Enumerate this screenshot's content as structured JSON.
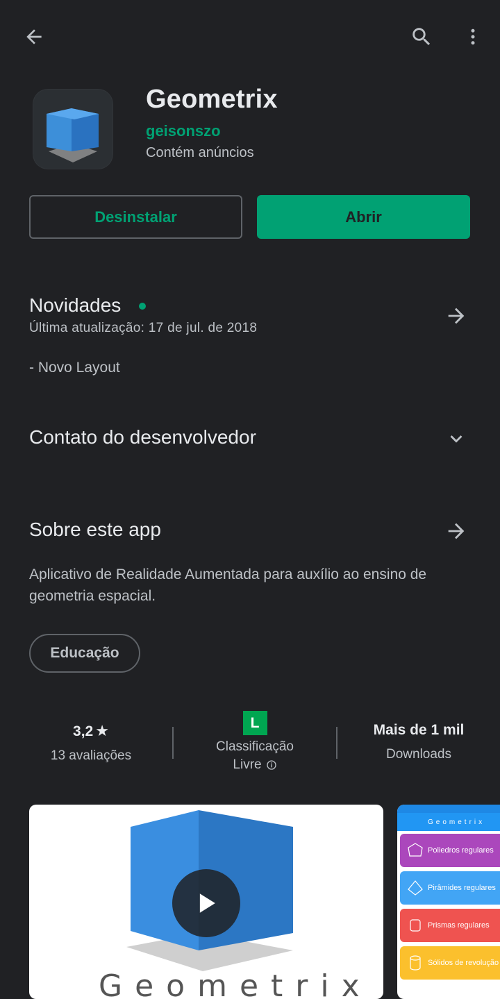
{
  "topbar": {
    "back_icon": "arrow-back-icon",
    "search_icon": "search-icon",
    "more_icon": "more-vert-icon"
  },
  "app": {
    "title": "Geometrix",
    "developer": "geisonszo",
    "ads_notice": "Contém anúncios",
    "icon": "blue-cube-icon"
  },
  "actions": {
    "uninstall_label": "Desinstalar",
    "open_label": "Abrir"
  },
  "news": {
    "title": "Novidades",
    "date": "Última atualização: 17 de jul. de 2018",
    "body": "- Novo Layout"
  },
  "contact": {
    "title": "Contato do desenvolvedor"
  },
  "about": {
    "title": "Sobre este app",
    "body": "Aplicativo de Realidade Aumentada para auxílio ao ensino de geometria espacial.",
    "category": "Educação"
  },
  "stats": {
    "rating_value": "3,2",
    "rating_star": "★",
    "rating_count": "13 avaliações",
    "classification_badge": "L",
    "classification_label": "Classificação",
    "classification_value": "Livre",
    "downloads_value": "Mais de 1 mil",
    "downloads_label": "Downloads"
  },
  "screenshots": {
    "video_caption": "Geometrix",
    "shot2_title": "Geometrix",
    "shot2_items": [
      "Poliedros regulares",
      "Pirâmides regulares",
      "Prismas regulares",
      "Sólidos de revolução"
    ]
  },
  "colors": {
    "accent": "#01A173",
    "background": "#202124",
    "rating_badge": "#00A651"
  }
}
